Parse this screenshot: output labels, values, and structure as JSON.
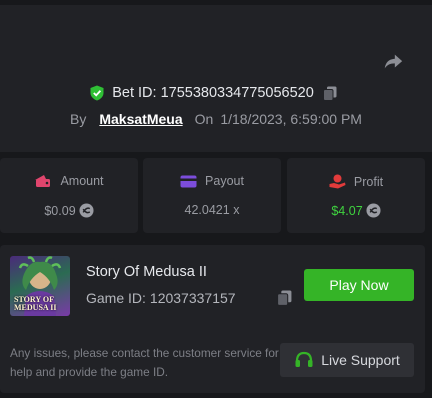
{
  "bet": {
    "id_label": "Bet ID:",
    "id": "1755380334775056520",
    "by_label": "By",
    "username": "MaksatMeua",
    "on_label": "On",
    "datetime": "1/18/2023, 6:59:00 PM"
  },
  "stats": {
    "amount": {
      "label": "Amount",
      "value": "$0.09",
      "icon": "wallet-icon"
    },
    "payout": {
      "label": "Payout",
      "value": "42.0421 x",
      "icon": "card-icon"
    },
    "profit": {
      "label": "Profit",
      "value": "$4.07",
      "icon": "coin-hand-icon"
    }
  },
  "game": {
    "title": "Story Of Medusa II",
    "id_label": "Game ID:",
    "id": "12037337157",
    "thumb_text_line1": "STORY OF",
    "thumb_text_line2": "MEDUSA II",
    "play_label": "Play Now"
  },
  "support": {
    "notice": "Any issues, please contact the customer service for help and provide the game ID.",
    "button_label": "Live Support"
  },
  "colors": {
    "accent_green": "#35b427",
    "profit_green": "#3fd33f",
    "amount_icon": "#e0456d",
    "payout_icon": "#7c4ddb",
    "profit_icon": "#e23b3b"
  }
}
